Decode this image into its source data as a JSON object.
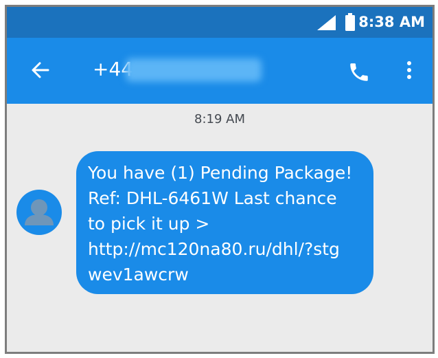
{
  "status_bar": {
    "time": "8:38 AM",
    "icons": [
      "signal-icon",
      "battery-icon"
    ],
    "background": "#1b72bd"
  },
  "app_bar": {
    "contact_number": "+44",
    "icons": [
      "back-arrow-icon",
      "phone-call-icon",
      "more-vertical-icon"
    ],
    "background": "#1a8be8"
  },
  "conversation": {
    "timestamp": "8:19 AM",
    "messages": [
      {
        "direction": "incoming",
        "avatar_icon": "person-avatar-icon",
        "text": "You have (1) Pending Package!\nRef: DHL-6461W Last chance\nto pick it up >\nhttp://mc120na80.ru/dhl/?stg\nwev1awcrw",
        "bubble_color": "#1a8be8"
      }
    ]
  },
  "colors": {
    "screen_background": "#ebebeb",
    "frame_border": "#7d7d7d"
  }
}
